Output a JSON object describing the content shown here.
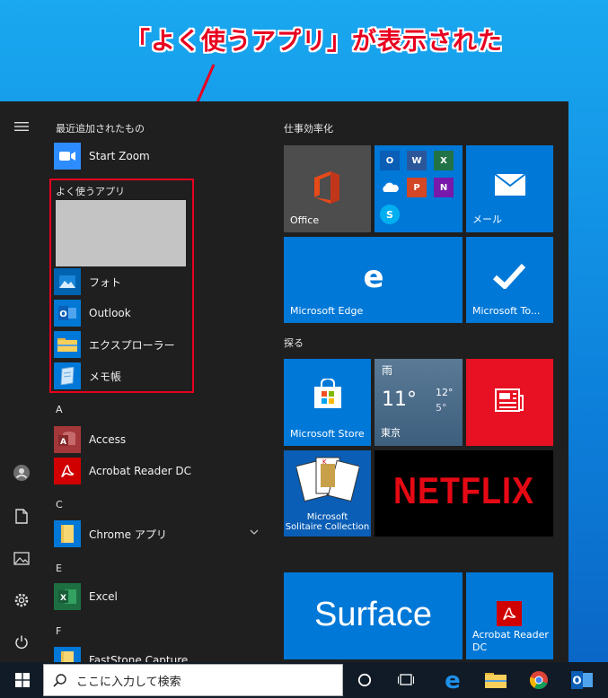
{
  "callout": {
    "text": "「よく使うアプリ」が表示された",
    "color": "#e8001f"
  },
  "applist": {
    "recent_header": "最近追加されたもの",
    "recent_app": "Start Zoom",
    "frequent_header": "よく使うアプリ",
    "frequent": [
      "フォト",
      "Outlook",
      "エクスプローラー",
      "メモ帳"
    ],
    "letters": [
      "A",
      "C",
      "E",
      "F"
    ],
    "apps": [
      "Access",
      "Acrobat Reader DC",
      "Chrome アプリ",
      "Excel",
      "FastStone Capture"
    ]
  },
  "tiles": {
    "groups": [
      "仕事効率化",
      "探る"
    ],
    "office": "Office",
    "mail": "メール",
    "edge": "Microsoft Edge",
    "todo": "Microsoft To...",
    "store": "Microsoft Store",
    "weather": {
      "condition": "雨",
      "temp": "11°",
      "high": "12°",
      "low": "5°",
      "city": "東京"
    },
    "solitaire": "Microsoft\nSolitaire Collection",
    "netflix": "NETFLIX",
    "surface": "Surface",
    "acrobat": "Acrobat Reader DC"
  },
  "taskbar": {
    "search_placeholder": "ここに入力して検索"
  },
  "colors": {
    "tile_blue": "#0078d7",
    "netflix_red": "#e50914",
    "news_red": "#e81123",
    "panel_bg": "#1f1f1f"
  },
  "icons": [
    "hamburger-icon",
    "user-icon",
    "document-icon",
    "pictures-icon",
    "settings-icon",
    "power-icon",
    "windows-icon",
    "search-icon",
    "cortana-icon",
    "task-view-icon",
    "edge-icon",
    "file-explorer-icon",
    "chrome-icon",
    "outlook-icon"
  ]
}
